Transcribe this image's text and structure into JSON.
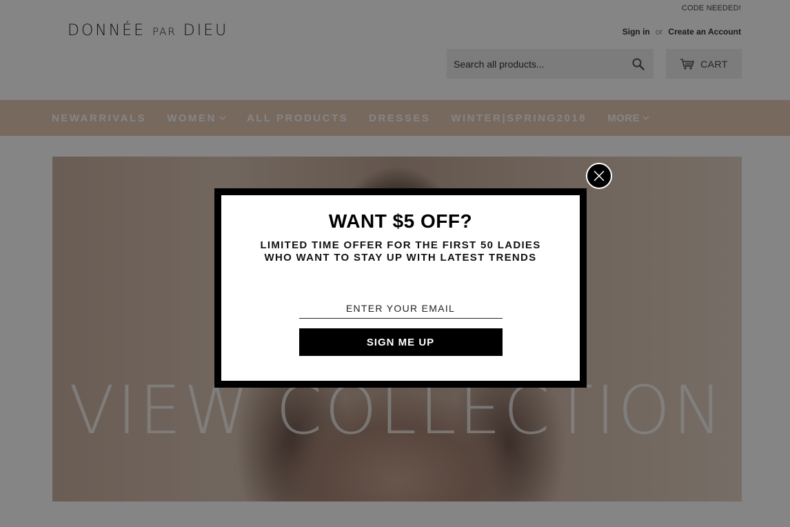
{
  "header": {
    "top_note": "CODE NEEDED!",
    "logo": {
      "part1": "DONNÉE",
      "part2": "PAR",
      "part3": "DIEU"
    },
    "sign_in": "Sign in",
    "or": "or",
    "create_account": "Create an Account",
    "search_placeholder": "Search all products...",
    "cart_label": "CART"
  },
  "nav": {
    "items": [
      {
        "label": "NEWARRIVALS"
      },
      {
        "label": "WOMEN"
      },
      {
        "label": "ALL PRODUCTS"
      },
      {
        "label": "DRESSES"
      },
      {
        "label": "WINTER|SPRING2018"
      },
      {
        "label": "MORE"
      }
    ]
  },
  "hero": {
    "text": "VIEW COLLECTION"
  },
  "popup": {
    "title": "WANT $5 OFF?",
    "subtitle_line1": "LIMITED TIME OFFER FOR THE FIRST 50 LADIES",
    "subtitle_line2": "WHO WANT TO STAY UP WITH LATEST TRENDS",
    "email_placeholder": "ENTER YOUR EMAIL",
    "button_label": "SIGN ME UP"
  },
  "colors": {
    "nav_bg": "#e6c9b5",
    "popup_frame": "#000000",
    "button_bg": "#000000"
  },
  "icons": {
    "search": "search-icon",
    "cart": "cart-icon",
    "dropdown": "chevron-down-icon",
    "close": "close-icon"
  }
}
